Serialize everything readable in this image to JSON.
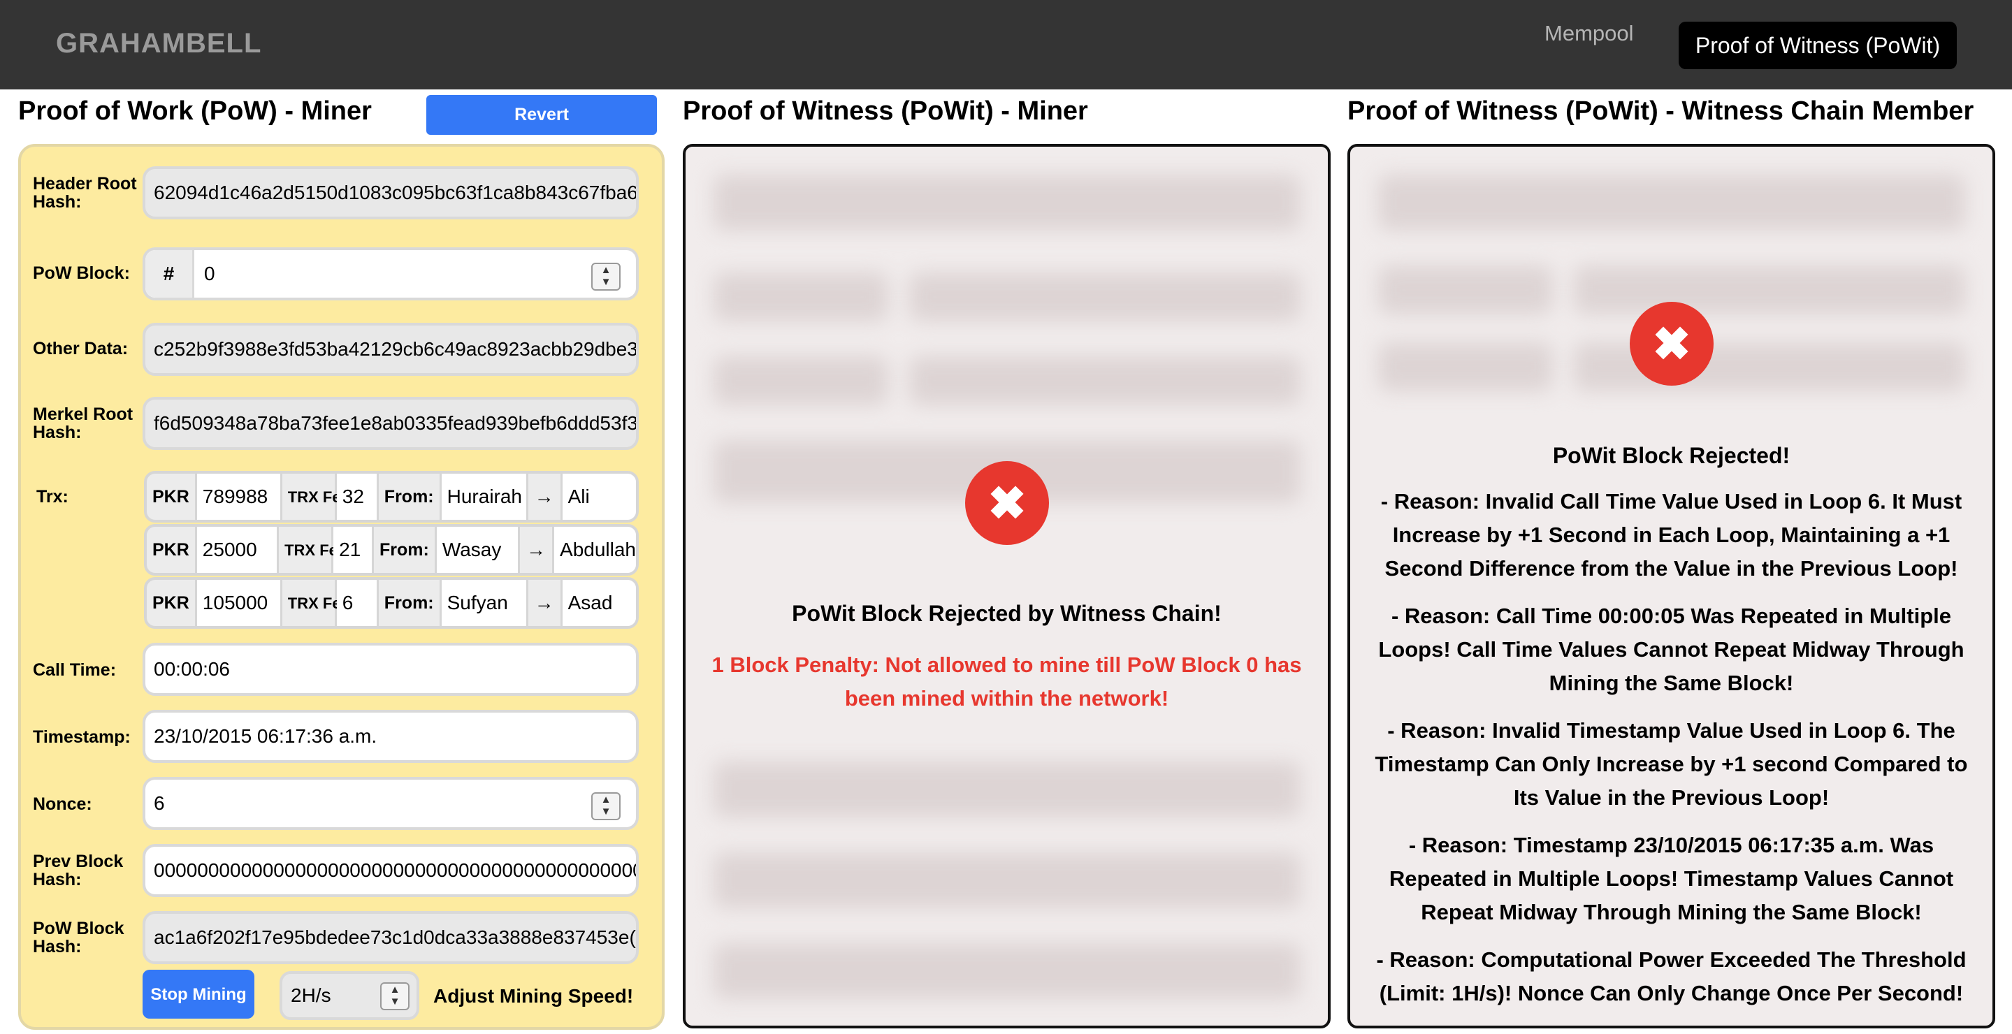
{
  "brand": "GRAHAMBELL",
  "nav": {
    "mempool": "Mempool",
    "active": "Proof of Witness (PoWit)"
  },
  "pow_miner": {
    "title": "Proof of Work (PoW) - Miner",
    "revert_label": "Revert",
    "header_root_hash": {
      "label": "Header Root Hash:",
      "value": "62094d1c46a2d5150d1083c095bc63f1ca8b843c67fba6"
    },
    "pow_block": {
      "label": "PoW Block:",
      "prefix": "#",
      "value": "0"
    },
    "other_data": {
      "label": "Other Data:",
      "value": "c252b9f3988e3fd53ba42129cb6c49ac8923acbb29dbe3"
    },
    "merkel_root_hash": {
      "label": "Merkel Root Hash:",
      "value": "f6d509348a78ba73fee1e8ab0335fead939befb6ddd53f3"
    },
    "trx_label": "Trx:",
    "trx": [
      {
        "currency": "PKR",
        "amount": "789988",
        "fee_label": "TRX Fee:",
        "fee": "32",
        "from_label": "From:",
        "from": "Hurairah",
        "arrow": "→",
        "to": "Ali"
      },
      {
        "currency": "PKR",
        "amount": "25000",
        "fee_label": "TRX Fee:",
        "fee": "21",
        "from_label": "From:",
        "from": "Wasay",
        "arrow": "→",
        "to": "Abdullah"
      },
      {
        "currency": "PKR",
        "amount": "105000",
        "fee_label": "TRX Fee:",
        "fee": "6",
        "from_label": "From:",
        "from": "Sufyan",
        "arrow": "→",
        "to": "Asad"
      }
    ],
    "call_time": {
      "label": "Call Time:",
      "value": "00:00:06"
    },
    "timestamp": {
      "label": "Timestamp:",
      "value": "23/10/2015 06:17:36 a.m."
    },
    "nonce": {
      "label": "Nonce:",
      "value": "6"
    },
    "prev_block_hash": {
      "label": "Prev Block Hash:",
      "value": "0000000000000000000000000000000000000000000000"
    },
    "pow_block_hash": {
      "label": "PoW Block Hash:",
      "value": "ac1a6f202f17e95bdedee73c1d0dca33a3888e837453e("
    },
    "stop_label": "Stop Mining",
    "speed_value": "2H/s",
    "adjust_label": "Adjust Mining Speed!"
  },
  "powit_miner": {
    "title": "Proof of Witness (PoWit) - Miner",
    "status": "PoWit Block Rejected by Witness Chain!",
    "penalty": "1 Block Penalty: Not allowed to mine till PoW Block 0 has been mined within the network!",
    "penalty_color": "#e7372e"
  },
  "witness_member": {
    "title": "Proof of Witness (PoWit) - Witness Chain Member",
    "status": "PoWit Block Rejected!",
    "reasons": [
      "- Reason: Invalid Call Time Value Used in Loop 6. It Must Increase by +1 Second in Each Loop, Maintaining a +1 Second Difference from the Value in the Previous Loop!",
      "- Reason: Call Time 00:00:05 Was Repeated in Multiple Loops! Call Time Values Cannot Repeat Midway Through Mining the Same Block!",
      "- Reason: Invalid Timestamp Value Used in Loop 6. The Timestamp Can Only Increase by +1 second Compared to Its Value in the Previous Loop!",
      "- Reason: Timestamp 23/10/2015 06:17:35 a.m. Was Repeated in Multiple Loops! Timestamp Values Cannot Repeat Midway Through Mining the Same Block!",
      "- Reason: Computational Power Exceeded The Threshold (Limit: 1H/s)! Nonce Can Only Change Once Per Second!"
    ]
  },
  "colors": {
    "accent_blue": "#3478f6",
    "card_yellow": "#fdeba0",
    "reject_red": "#e7372e",
    "topbar": "#343434"
  }
}
